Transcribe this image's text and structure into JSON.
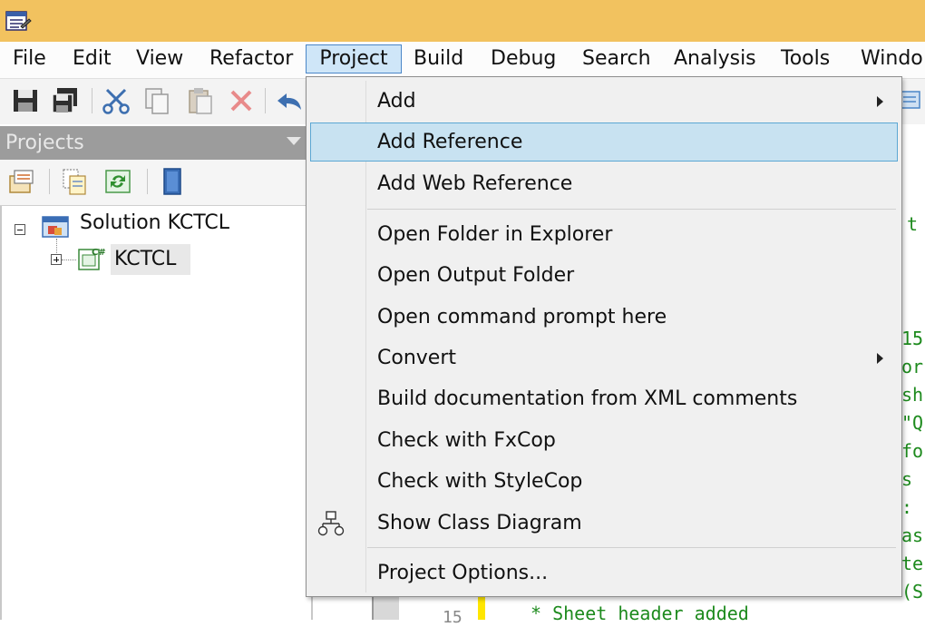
{
  "menubar": {
    "items": [
      "File",
      "Edit",
      "View",
      "Refactor",
      "Project",
      "Build",
      "Debug",
      "Search",
      "Analysis",
      "Tools",
      "Windo"
    ],
    "active": "Project"
  },
  "projects_pad": {
    "title": "Projects",
    "tree": {
      "solution": "Solution KCTCL",
      "project": "KCTCL"
    }
  },
  "project_menu": {
    "items": [
      {
        "label": "Add",
        "submenu": true
      },
      {
        "label": "Add Reference",
        "highlighted": true
      },
      {
        "label": "Add Web Reference"
      },
      {
        "label": "Open Folder in Explorer"
      },
      {
        "label": "Open Output Folder"
      },
      {
        "label": "Open command prompt here"
      },
      {
        "label": "Convert",
        "submenu": true
      },
      {
        "label": "Build documentation from XML comments"
      },
      {
        "label": "Check with FxCop"
      },
      {
        "label": "Check with StyleCop"
      },
      {
        "label": "Show Class Diagram",
        "icon": "class-diagram-icon"
      },
      {
        "label": "Project Options..."
      }
    ]
  },
  "editor": {
    "fragments": [
      "t",
      "15",
      "or",
      "sh",
      "\"Q",
      "fo",
      " s",
      ":",
      "as",
      "te",
      "(S"
    ],
    "line_number": "15",
    "bottom_line": "*    Sheet header added"
  },
  "colors": {
    "titlebar": "#f2c25f",
    "highlight": "#c8e2f1",
    "code_comment": "#1d8a1d"
  }
}
